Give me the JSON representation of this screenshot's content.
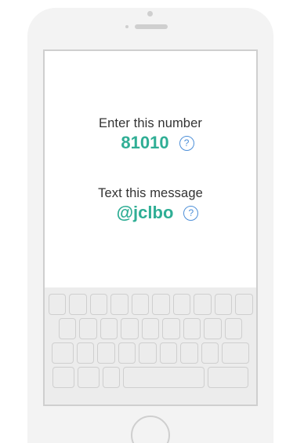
{
  "number_section": {
    "label": "Enter this number",
    "value": "81010",
    "help_icon": "question-circle-icon"
  },
  "message_section": {
    "label": "Text this message",
    "value": "@jclbo",
    "help_icon": "question-circle-icon"
  },
  "colors": {
    "accent": "#2fae95",
    "help": "#4d8fd8",
    "phone_frame": "#cfcfcf"
  }
}
